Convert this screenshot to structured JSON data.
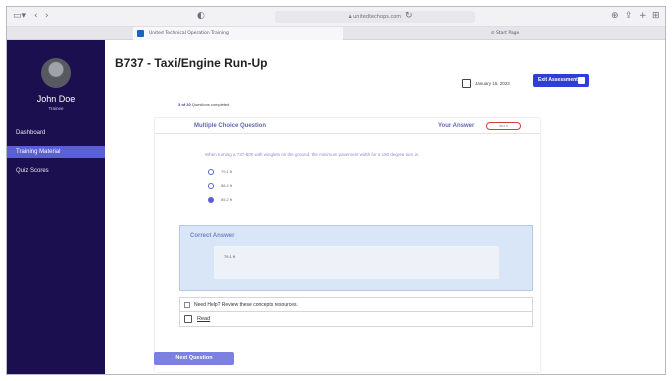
{
  "browser": {
    "url": "unitedtechops.com",
    "tabs": [
      {
        "label": "United Technical Operation Training"
      },
      {
        "label": "Start Page"
      }
    ]
  },
  "sidebar": {
    "user_name": "John Doe",
    "user_role": "Trainee",
    "items": [
      {
        "label": "Dashboard",
        "active": false
      },
      {
        "label": "Training Material",
        "active": true
      },
      {
        "label": "Quiz Scores",
        "active": false
      }
    ]
  },
  "header": {
    "title": "B737 - Taxi/Engine Run-Up",
    "date": "January 15, 2023",
    "exit_label": "Exit Assessment"
  },
  "progress": {
    "count": "3 of 20",
    "label": "Questions completed"
  },
  "question": {
    "type_label": "Multiple Choice Question",
    "your_answer_label": "Your Answer",
    "your_answer_value": "85.2 ft",
    "text": "When turning a 737-800 with winglets on the ground, the minimum pavement width for a 180 degree turn is:",
    "options": [
      {
        "label": "79.1 ft",
        "checked": false
      },
      {
        "label": "88.4 ft",
        "checked": false
      },
      {
        "label": "85.2 ft",
        "checked": true
      }
    ]
  },
  "correct": {
    "title": "Correct Answer",
    "value": "79.1 ft"
  },
  "help": {
    "text": "Need Help? Review these  concepts resources.",
    "read_label": "Read"
  },
  "next_label": "Next Question",
  "colors": {
    "sidebar_bg": "#1b0f4f",
    "accent": "#5b5fd6",
    "exit_button": "#2e3ed8"
  }
}
